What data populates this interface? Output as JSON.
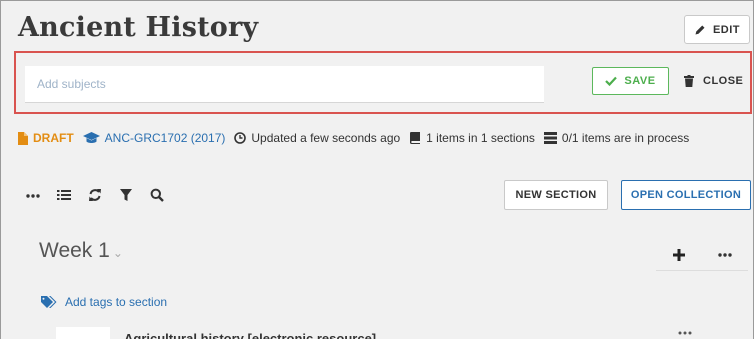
{
  "header": {
    "title": "Ancient History",
    "edit_label": "EDIT"
  },
  "subjects": {
    "placeholder": "Add subjects",
    "value": "",
    "save_label": "SAVE",
    "close_label": "CLOSE"
  },
  "meta": {
    "status": "DRAFT",
    "course": "ANC-GRC1702 (2017)",
    "updated": "Updated a few seconds ago",
    "items_summary": "1 items in 1 sections",
    "process_summary": "0/1 items are in process"
  },
  "toolbar": {
    "new_section_label": "NEW SECTION",
    "open_collection_label": "OPEN COLLECTION",
    "icons": [
      "more-icon",
      "list-icon",
      "refresh-icon",
      "filter-icon",
      "search-icon"
    ]
  },
  "section": {
    "title": "Week 1",
    "add_tags_label": "Add tags to section"
  },
  "items": [
    {
      "title": "Agricultural history [electronic resource]"
    }
  ],
  "colors": {
    "accent_blue": "#2a6fb0",
    "draft_orange": "#e38d13",
    "save_green": "#5cb85c",
    "highlight_red": "#d9534f"
  }
}
